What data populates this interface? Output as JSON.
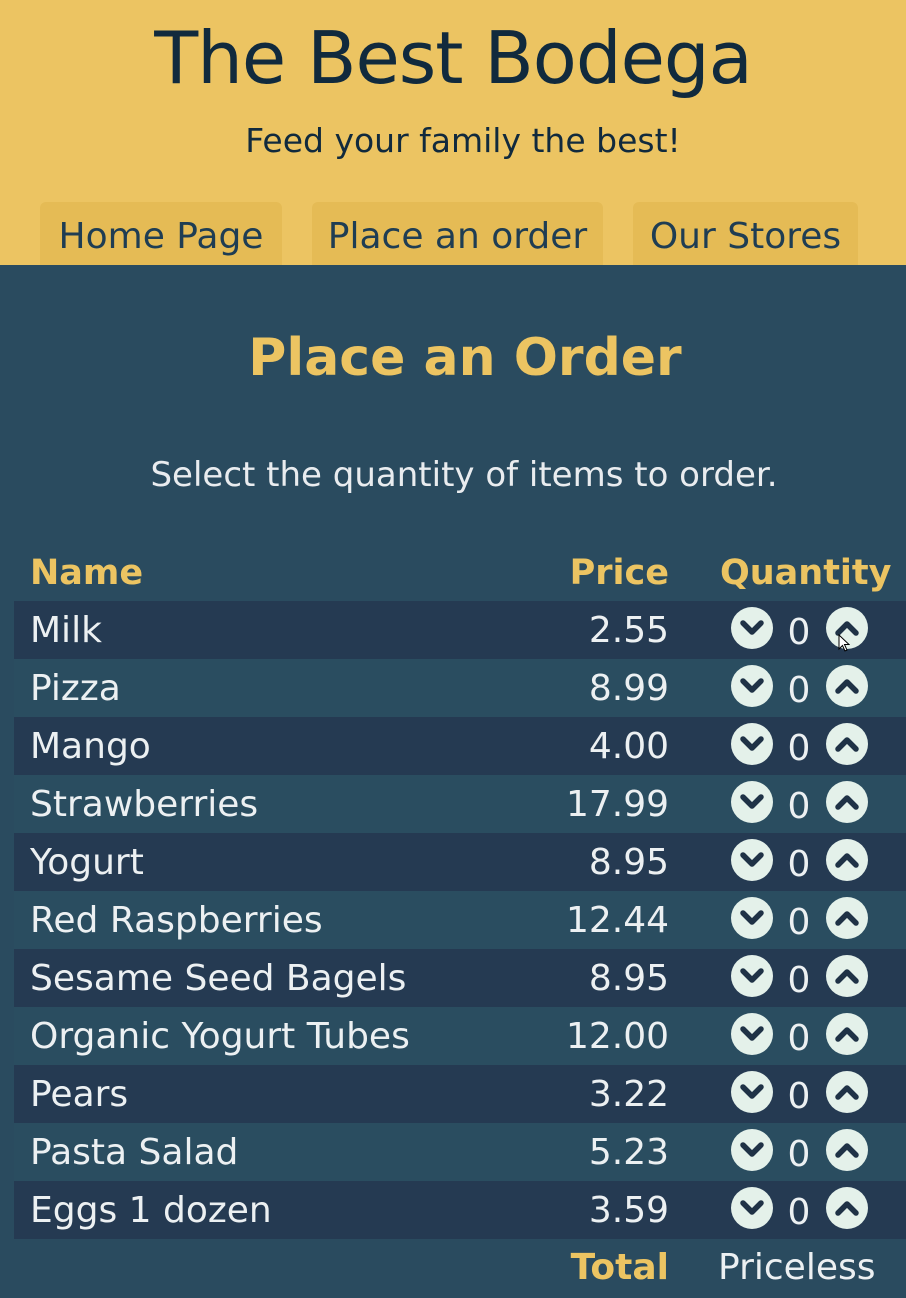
{
  "header": {
    "title": "The Best Bodega",
    "tagline": "Feed your family the best!",
    "nav": [
      {
        "label": "Home Page"
      },
      {
        "label": "Place an order"
      },
      {
        "label": "Our Stores"
      }
    ]
  },
  "main": {
    "heading": "Place an Order",
    "instructions": "Select the quantity of items to order."
  },
  "table": {
    "columns": [
      "Name",
      "Price",
      "Quantity"
    ],
    "rows": [
      {
        "name": "Milk",
        "price": "2.55",
        "quantity": "0"
      },
      {
        "name": "Pizza",
        "price": "8.99",
        "quantity": "0"
      },
      {
        "name": "Mango",
        "price": "4.00",
        "quantity": "0"
      },
      {
        "name": "Strawberries",
        "price": "17.99",
        "quantity": "0"
      },
      {
        "name": "Yogurt",
        "price": "8.95",
        "quantity": "0"
      },
      {
        "name": "Red Raspberries",
        "price": "12.44",
        "quantity": "0"
      },
      {
        "name": "Sesame Seed Bagels",
        "price": "8.95",
        "quantity": "0"
      },
      {
        "name": "Organic Yogurt Tubes",
        "price": "12.00",
        "quantity": "0"
      },
      {
        "name": "Pears",
        "price": "3.22",
        "quantity": "0"
      },
      {
        "name": "Pasta Salad",
        "price": "5.23",
        "quantity": "0"
      },
      {
        "name": "Eggs 1 dozen",
        "price": "3.59",
        "quantity": "0"
      }
    ],
    "total_label": "Total",
    "total_value": "Priceless"
  },
  "icons": {
    "decrease": "chevron-down-icon",
    "increase": "chevron-up-icon"
  },
  "colors": {
    "header_bg": "#ecc462",
    "nav_tab_bg": "#e5bb55",
    "title_text": "#112a3d",
    "page_bg": "#2a4b5f",
    "row_dark": "#253a52",
    "row_light": "#2a4d60",
    "accent_text": "#ecc462",
    "body_text": "#ecf0f2",
    "button_bg": "#e4f1ea"
  }
}
